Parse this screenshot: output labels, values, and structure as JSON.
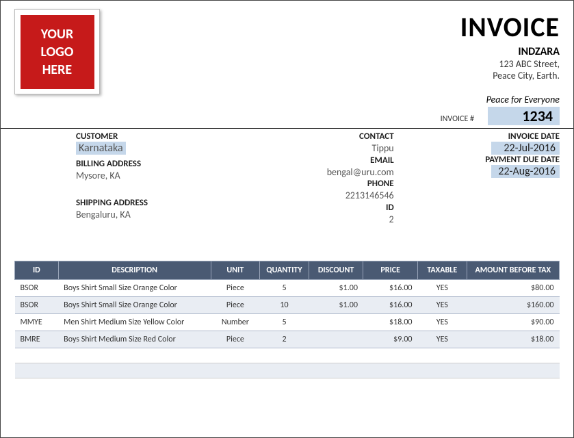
{
  "logo": {
    "line1": "YOUR",
    "line2": "LOGO",
    "line3": "HERE"
  },
  "header": {
    "invoice_title": "INVOICE",
    "company_name": "INDZARA",
    "addr1": "123 ABC Street,",
    "addr2": "Peace City, Earth.",
    "tagline": "Peace for Everyone"
  },
  "invoice": {
    "number_label": "INVOICE #",
    "number": "1234",
    "date_label": "INVOICE DATE",
    "date": "22-Jul-2016",
    "due_label": "PAYMENT DUE DATE",
    "due": "22-Aug-2016"
  },
  "customer": {
    "label": "CUSTOMER",
    "name": "Karnataka",
    "billing_label": "BILLING ADDRESS",
    "billing": "Mysore, KA",
    "shipping_label": "SHIPPING ADDRESS",
    "shipping": "Bengaluru, KA"
  },
  "contact": {
    "contact_label": "CONTACT",
    "contact": "Tippu",
    "email_label": "EMAIL",
    "email": "bengal@uru.com",
    "phone_label": "PHONE",
    "phone": "2213146546",
    "id_label": "ID",
    "id": "2"
  },
  "table": {
    "headers": [
      "ID",
      "DESCRIPTION",
      "UNIT",
      "QUANTITY",
      "DISCOUNT",
      "PRICE",
      "TAXABLE",
      "AMOUNT BEFORE TAX"
    ],
    "rows": [
      {
        "id": "BSOR",
        "desc": "Boys Shirt Small Size Orange Color",
        "unit": "Piece",
        "qty": "5",
        "disc": "$1.00",
        "price": "$16.00",
        "tax": "YES",
        "amount": "$80.00"
      },
      {
        "id": "BSOR",
        "desc": "Boys Shirt Small Size Orange Color",
        "unit": "Piece",
        "qty": "10",
        "disc": "$1.00",
        "price": "$16.00",
        "tax": "YES",
        "amount": "$160.00"
      },
      {
        "id": "MMYE",
        "desc": "Men Shirt Medium Size Yellow Color",
        "unit": "Number",
        "qty": "5",
        "disc": "",
        "price": "$18.00",
        "tax": "YES",
        "amount": "$90.00"
      },
      {
        "id": "BMRE",
        "desc": "Boys Shirt Medium Size Red Color",
        "unit": "Piece",
        "qty": "2",
        "disc": "",
        "price": "$9.00",
        "tax": "YES",
        "amount": "$18.00"
      }
    ]
  }
}
